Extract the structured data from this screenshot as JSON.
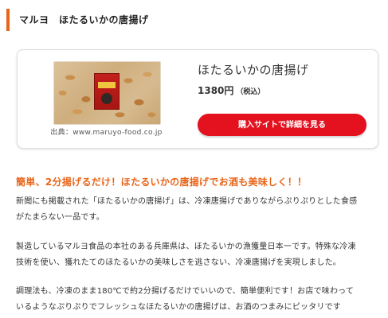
{
  "heading": "マルヨ　ほたるいかの唐揚げ",
  "product": {
    "image_alt": "ほたるいかの唐揚げ",
    "source_text": "出典：www.maruyo-food.co.jp",
    "title": "ほたるいかの唐揚げ",
    "price": "1380円",
    "tax_note": "（税込）",
    "buy_button_label": "購入サイトで詳細を見る"
  },
  "article": {
    "catchphrase": "簡単、2分揚げるだけ！ほたるいかの唐揚げでお酒も美味しく！！",
    "paragraph1": [
      "新聞にも掲載された「ほたるいかの唐揚げ」は、冷凍唐揚げでありながらぷりぷりとした食感",
      "がたまらない一品です。"
    ],
    "paragraph2": [
      "製造しているマルヨ食品の本社のある兵庫県は、ほたるいかの漁獲量日本一です。特殊な冷凍",
      "技術を使い、獲れたてのほたるいかの美味しさを逃さない、冷凍唐揚げを実現しました。"
    ],
    "paragraph3": [
      "調理法も、冷凍のまま180℃で約2分揚げるだけでいいので、簡単便利です！お店で味わって",
      "いるようなぷりぷりでフレッシュなほたるいかの唐揚げは、お酒のつまみにピッタリです"
    ]
  },
  "colors": {
    "accent": "#e8651a",
    "buy_button": "#e3121e"
  }
}
